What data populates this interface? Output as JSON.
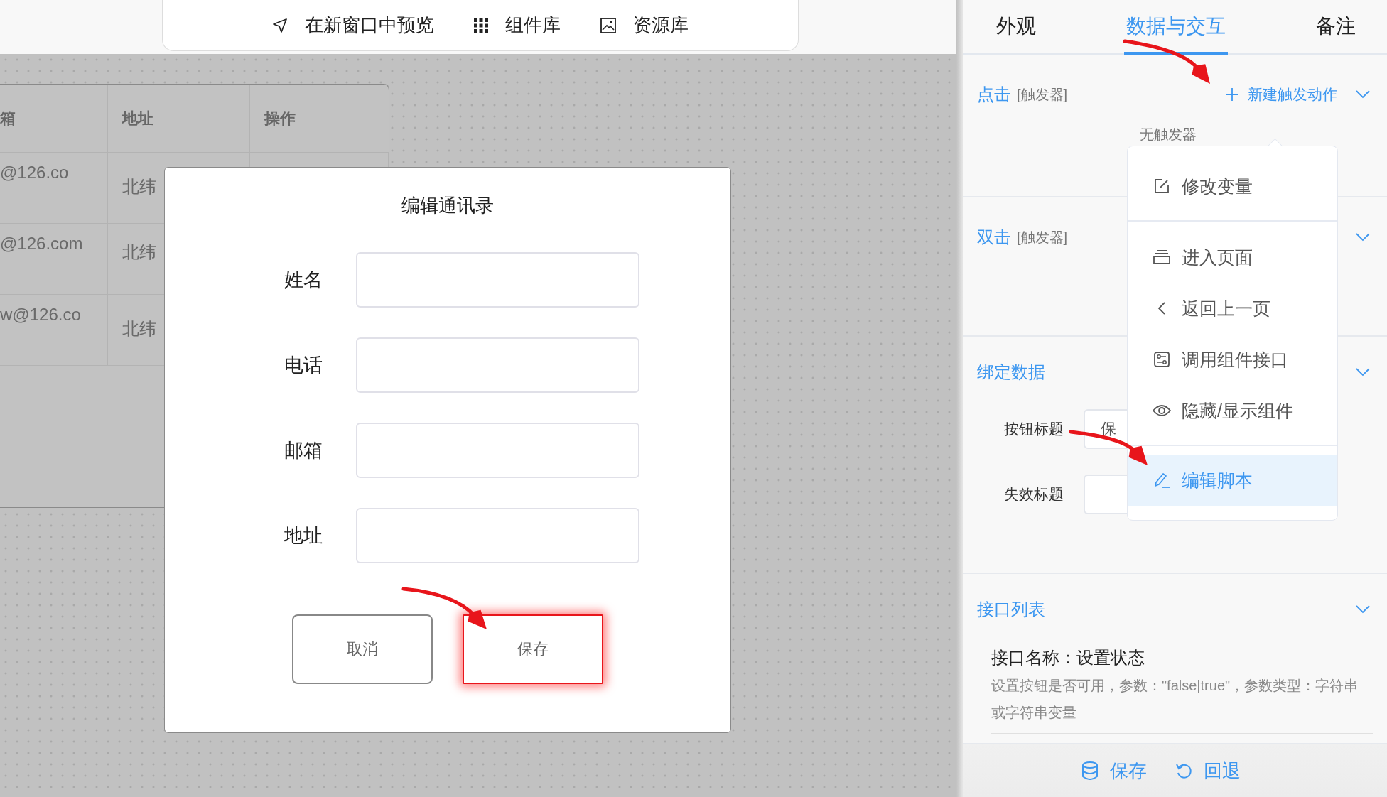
{
  "toolbar": {
    "items": [
      {
        "kind": "preview",
        "label": "在新窗口中预览"
      },
      {
        "kind": "components",
        "label": "组件库"
      },
      {
        "kind": "assets",
        "label": "资源库"
      }
    ]
  },
  "table": {
    "columns": [
      "箱",
      "地址",
      "操作"
    ],
    "rows": [
      [
        "@126.co",
        "北纬"
      ],
      [
        "@126.com",
        "北纬"
      ],
      [
        "w@126.co",
        "北纬"
      ]
    ]
  },
  "dialog": {
    "title": "编辑通讯录",
    "fields": [
      {
        "label": "姓名"
      },
      {
        "label": "电话"
      },
      {
        "label": "邮箱"
      },
      {
        "label": "地址"
      }
    ],
    "buttons": [
      {
        "label": "取消",
        "highlighted": false
      },
      {
        "label": "保存",
        "highlighted": true
      }
    ]
  },
  "panel": {
    "tabs": [
      {
        "label": "外观",
        "selected": false
      },
      {
        "label": "数据与交互",
        "selected": true
      },
      {
        "label": "备注",
        "selected": false
      }
    ],
    "sections": [
      {
        "kind": "trigger",
        "title": "点击",
        "tag": "[触发器]",
        "action": "新建触发动作",
        "note": "无触发器"
      },
      {
        "kind": "trigger",
        "title": "双击",
        "tag": "[触发器]"
      },
      {
        "kind": "binding",
        "title": "绑定数据",
        "fields": [
          {
            "label": "按钮标题",
            "value": "保"
          },
          {
            "label": "失效标题"
          }
        ]
      },
      {
        "kind": "interfaces",
        "title": "接口列表",
        "items": [
          {
            "name": "接口名称：设置状态",
            "description": "设置按钮是否可用，参数：\"false|true\"，参数类型：字符串或字符串变量"
          }
        ]
      }
    ],
    "footer": [
      {
        "kind": "save",
        "label": "保存"
      },
      {
        "kind": "revert",
        "label": "回退"
      }
    ]
  },
  "menu": {
    "groups": [
      {
        "items": [
          {
            "kind": "edit",
            "label": "修改变量",
            "selected": false
          }
        ]
      },
      {
        "items": [
          {
            "kind": "page",
            "label": "进入页面",
            "selected": false
          },
          {
            "kind": "back",
            "label": "返回上一页",
            "selected": false
          },
          {
            "kind": "call",
            "label": "调用组件接口",
            "selected": false
          },
          {
            "kind": "visibility",
            "label": "隐藏/显示组件",
            "selected": false
          }
        ]
      },
      {
        "items": [
          {
            "kind": "script",
            "label": "编辑脚本",
            "selected": true
          }
        ]
      }
    ]
  }
}
